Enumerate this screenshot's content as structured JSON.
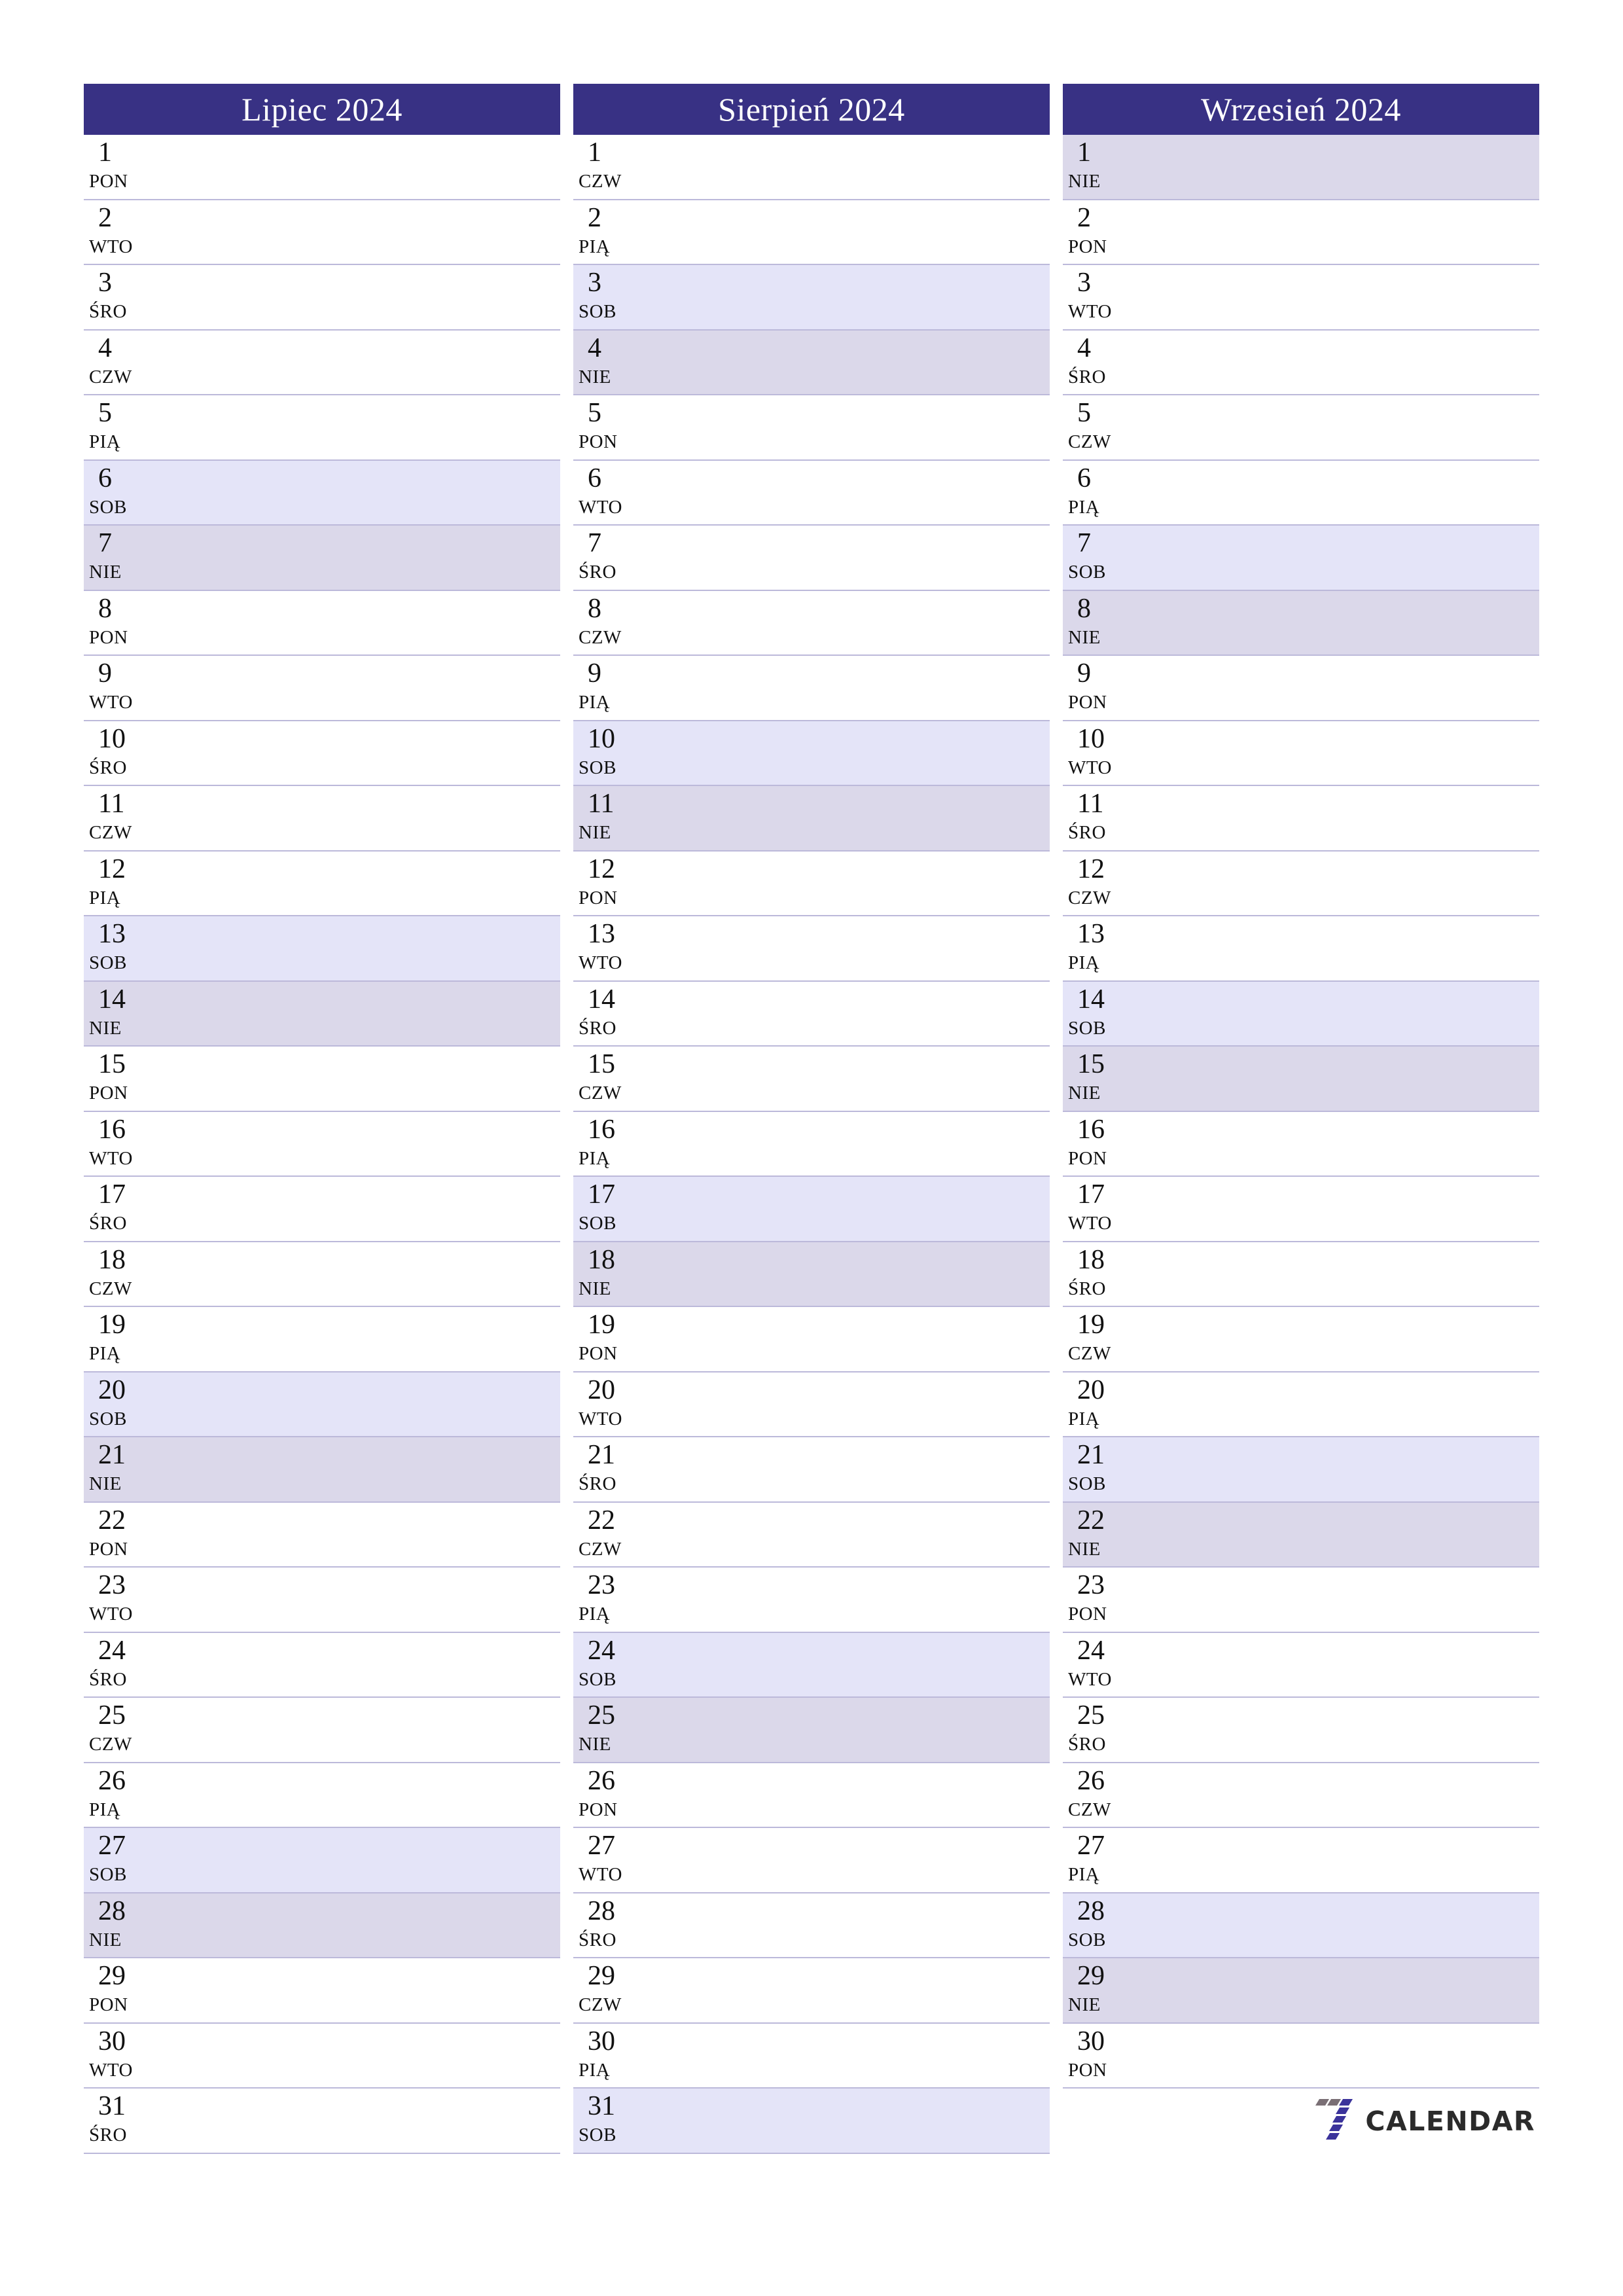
{
  "theme": {
    "header_bg": "#383184",
    "header_text": "#ffffff",
    "saturday_bg": "#e4e4f8",
    "sunday_bg": "#dbd8ea",
    "row_border": "#bcb9da",
    "page_bg": "#ffffff",
    "day_text": "#111111"
  },
  "logo": {
    "word": "CALENDAR",
    "mark_colors": [
      "#7a6f75",
      "#3b339b"
    ]
  },
  "months": [
    {
      "title": "Lipiec 2024",
      "days": [
        {
          "num": "1",
          "name": "PON",
          "kind": "weekday"
        },
        {
          "num": "2",
          "name": "WTO",
          "kind": "weekday"
        },
        {
          "num": "3",
          "name": "ŚRO",
          "kind": "weekday"
        },
        {
          "num": "4",
          "name": "CZW",
          "kind": "weekday"
        },
        {
          "num": "5",
          "name": "PIĄ",
          "kind": "weekday"
        },
        {
          "num": "6",
          "name": "SOB",
          "kind": "sat"
        },
        {
          "num": "7",
          "name": "NIE",
          "kind": "sun"
        },
        {
          "num": "8",
          "name": "PON",
          "kind": "weekday"
        },
        {
          "num": "9",
          "name": "WTO",
          "kind": "weekday"
        },
        {
          "num": "10",
          "name": "ŚRO",
          "kind": "weekday"
        },
        {
          "num": "11",
          "name": "CZW",
          "kind": "weekday"
        },
        {
          "num": "12",
          "name": "PIĄ",
          "kind": "weekday"
        },
        {
          "num": "13",
          "name": "SOB",
          "kind": "sat"
        },
        {
          "num": "14",
          "name": "NIE",
          "kind": "sun"
        },
        {
          "num": "15",
          "name": "PON",
          "kind": "weekday"
        },
        {
          "num": "16",
          "name": "WTO",
          "kind": "weekday"
        },
        {
          "num": "17",
          "name": "ŚRO",
          "kind": "weekday"
        },
        {
          "num": "18",
          "name": "CZW",
          "kind": "weekday"
        },
        {
          "num": "19",
          "name": "PIĄ",
          "kind": "weekday"
        },
        {
          "num": "20",
          "name": "SOB",
          "kind": "sat"
        },
        {
          "num": "21",
          "name": "NIE",
          "kind": "sun"
        },
        {
          "num": "22",
          "name": "PON",
          "kind": "weekday"
        },
        {
          "num": "23",
          "name": "WTO",
          "kind": "weekday"
        },
        {
          "num": "24",
          "name": "ŚRO",
          "kind": "weekday"
        },
        {
          "num": "25",
          "name": "CZW",
          "kind": "weekday"
        },
        {
          "num": "26",
          "name": "PIĄ",
          "kind": "weekday"
        },
        {
          "num": "27",
          "name": "SOB",
          "kind": "sat"
        },
        {
          "num": "28",
          "name": "NIE",
          "kind": "sun"
        },
        {
          "num": "29",
          "name": "PON",
          "kind": "weekday"
        },
        {
          "num": "30",
          "name": "WTO",
          "kind": "weekday"
        },
        {
          "num": "31",
          "name": "ŚRO",
          "kind": "weekday"
        }
      ],
      "logo_slot": false
    },
    {
      "title": "Sierpień 2024",
      "days": [
        {
          "num": "1",
          "name": "CZW",
          "kind": "weekday"
        },
        {
          "num": "2",
          "name": "PIĄ",
          "kind": "weekday"
        },
        {
          "num": "3",
          "name": "SOB",
          "kind": "sat"
        },
        {
          "num": "4",
          "name": "NIE",
          "kind": "sun"
        },
        {
          "num": "5",
          "name": "PON",
          "kind": "weekday"
        },
        {
          "num": "6",
          "name": "WTO",
          "kind": "weekday"
        },
        {
          "num": "7",
          "name": "ŚRO",
          "kind": "weekday"
        },
        {
          "num": "8",
          "name": "CZW",
          "kind": "weekday"
        },
        {
          "num": "9",
          "name": "PIĄ",
          "kind": "weekday"
        },
        {
          "num": "10",
          "name": "SOB",
          "kind": "sat"
        },
        {
          "num": "11",
          "name": "NIE",
          "kind": "sun"
        },
        {
          "num": "12",
          "name": "PON",
          "kind": "weekday"
        },
        {
          "num": "13",
          "name": "WTO",
          "kind": "weekday"
        },
        {
          "num": "14",
          "name": "ŚRO",
          "kind": "weekday"
        },
        {
          "num": "15",
          "name": "CZW",
          "kind": "weekday"
        },
        {
          "num": "16",
          "name": "PIĄ",
          "kind": "weekday"
        },
        {
          "num": "17",
          "name": "SOB",
          "kind": "sat"
        },
        {
          "num": "18",
          "name": "NIE",
          "kind": "sun"
        },
        {
          "num": "19",
          "name": "PON",
          "kind": "weekday"
        },
        {
          "num": "20",
          "name": "WTO",
          "kind": "weekday"
        },
        {
          "num": "21",
          "name": "ŚRO",
          "kind": "weekday"
        },
        {
          "num": "22",
          "name": "CZW",
          "kind": "weekday"
        },
        {
          "num": "23",
          "name": "PIĄ",
          "kind": "weekday"
        },
        {
          "num": "24",
          "name": "SOB",
          "kind": "sat"
        },
        {
          "num": "25",
          "name": "NIE",
          "kind": "sun"
        },
        {
          "num": "26",
          "name": "PON",
          "kind": "weekday"
        },
        {
          "num": "27",
          "name": "WTO",
          "kind": "weekday"
        },
        {
          "num": "28",
          "name": "ŚRO",
          "kind": "weekday"
        },
        {
          "num": "29",
          "name": "CZW",
          "kind": "weekday"
        },
        {
          "num": "30",
          "name": "PIĄ",
          "kind": "weekday"
        },
        {
          "num": "31",
          "name": "SOB",
          "kind": "sat"
        }
      ],
      "logo_slot": false
    },
    {
      "title": "Wrzesień 2024",
      "days": [
        {
          "num": "1",
          "name": "NIE",
          "kind": "sun"
        },
        {
          "num": "2",
          "name": "PON",
          "kind": "weekday"
        },
        {
          "num": "3",
          "name": "WTO",
          "kind": "weekday"
        },
        {
          "num": "4",
          "name": "ŚRO",
          "kind": "weekday"
        },
        {
          "num": "5",
          "name": "CZW",
          "kind": "weekday"
        },
        {
          "num": "6",
          "name": "PIĄ",
          "kind": "weekday"
        },
        {
          "num": "7",
          "name": "SOB",
          "kind": "sat"
        },
        {
          "num": "8",
          "name": "NIE",
          "kind": "sun"
        },
        {
          "num": "9",
          "name": "PON",
          "kind": "weekday"
        },
        {
          "num": "10",
          "name": "WTO",
          "kind": "weekday"
        },
        {
          "num": "11",
          "name": "ŚRO",
          "kind": "weekday"
        },
        {
          "num": "12",
          "name": "CZW",
          "kind": "weekday"
        },
        {
          "num": "13",
          "name": "PIĄ",
          "kind": "weekday"
        },
        {
          "num": "14",
          "name": "SOB",
          "kind": "sat"
        },
        {
          "num": "15",
          "name": "NIE",
          "kind": "sun"
        },
        {
          "num": "16",
          "name": "PON",
          "kind": "weekday"
        },
        {
          "num": "17",
          "name": "WTO",
          "kind": "weekday"
        },
        {
          "num": "18",
          "name": "ŚRO",
          "kind": "weekday"
        },
        {
          "num": "19",
          "name": "CZW",
          "kind": "weekday"
        },
        {
          "num": "20",
          "name": "PIĄ",
          "kind": "weekday"
        },
        {
          "num": "21",
          "name": "SOB",
          "kind": "sat"
        },
        {
          "num": "22",
          "name": "NIE",
          "kind": "sun"
        },
        {
          "num": "23",
          "name": "PON",
          "kind": "weekday"
        },
        {
          "num": "24",
          "name": "WTO",
          "kind": "weekday"
        },
        {
          "num": "25",
          "name": "ŚRO",
          "kind": "weekday"
        },
        {
          "num": "26",
          "name": "CZW",
          "kind": "weekday"
        },
        {
          "num": "27",
          "name": "PIĄ",
          "kind": "weekday"
        },
        {
          "num": "28",
          "name": "SOB",
          "kind": "sat"
        },
        {
          "num": "29",
          "name": "NIE",
          "kind": "sun"
        },
        {
          "num": "30",
          "name": "PON",
          "kind": "weekday"
        }
      ],
      "logo_slot": true
    }
  ]
}
